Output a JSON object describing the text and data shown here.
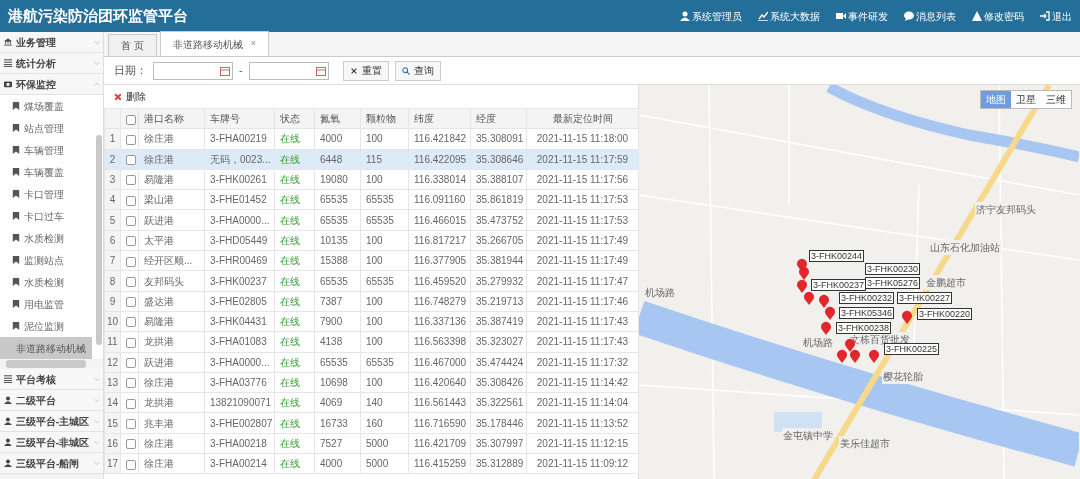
{
  "header": {
    "title": "港航污染防治团环监管平台",
    "menu": [
      {
        "label": "系统管理员"
      },
      {
        "label": "系统大数据"
      },
      {
        "label": "事件研发"
      },
      {
        "label": "消息列表"
      },
      {
        "label": "修改密码"
      },
      {
        "label": "退出"
      }
    ]
  },
  "sidebar": {
    "groups": [
      {
        "label": "业务管理",
        "expanded": false
      },
      {
        "label": "统计分析",
        "expanded": false
      },
      {
        "label": "环保监控",
        "expanded": true,
        "children": [
          {
            "label": "煤场覆盖",
            "selected": false
          },
          {
            "label": "站点管理",
            "selected": false
          },
          {
            "label": "车辆管理",
            "selected": false
          },
          {
            "label": "车辆覆盖",
            "selected": false
          },
          {
            "label": "卡口管理",
            "selected": false
          },
          {
            "label": "卡口过车",
            "selected": false
          },
          {
            "label": "水质检测",
            "selected": false
          },
          {
            "label": "监测站点",
            "selected": false
          },
          {
            "label": "水质检测",
            "selected": false
          },
          {
            "label": "用电监管",
            "selected": false
          },
          {
            "label": "泥位监测",
            "selected": false
          },
          {
            "label": "非道路移动机械",
            "selected": true
          }
        ]
      },
      {
        "label": "平台考核",
        "expanded": false
      },
      {
        "label": "二级平台",
        "expanded": false
      },
      {
        "label": "三级平台-主城区",
        "expanded": false
      },
      {
        "label": "三级平台-非城区",
        "expanded": false
      },
      {
        "label": "三级平台-船闸",
        "expanded": false
      }
    ]
  },
  "tabs": [
    {
      "label": "首 页",
      "selected": false,
      "closable": false
    },
    {
      "label": "非道路移动机械",
      "selected": true,
      "closable": true,
      "close": "×"
    }
  ],
  "filter": {
    "label": "日期：",
    "separator": "-",
    "buttons": [
      {
        "label": "重置"
      },
      {
        "label": "查询"
      }
    ]
  },
  "toolbar": {
    "delete": "删除"
  },
  "table": {
    "all_checked": false,
    "columns": [
      "港口名称",
      "车牌号",
      "状态",
      "氮氧",
      "颗粒物",
      "纬度",
      "经度",
      "最新定位时间"
    ],
    "rows": [
      {
        "index": "1",
        "checked": false,
        "selected": false,
        "cells": [
          "徐庄港",
          "3-FHA00219",
          "在线",
          "4000",
          "100",
          "116.421842",
          "35.308091",
          "2021-11-15 11:18:00"
        ]
      },
      {
        "index": "2",
        "checked": false,
        "selected": true,
        "cells": [
          "徐庄港",
          "无码，0023...",
          "在线",
          "6448",
          "115",
          "116.422095",
          "35.308646",
          "2021-11-15 11:17:59"
        ]
      },
      {
        "index": "3",
        "checked": false,
        "selected": false,
        "cells": [
          "易隆港",
          "3-FHK00261",
          "在线",
          "19080",
          "100",
          "116.338014",
          "35.388107",
          "2021-11-15 11:17:56"
        ]
      },
      {
        "index": "4",
        "checked": false,
        "selected": false,
        "cells": [
          "梁山港",
          "3-FHE01452",
          "在线",
          "65535",
          "65535",
          "116.091160",
          "35.861819",
          "2021-11-15 11:17:53"
        ]
      },
      {
        "index": "5",
        "checked": false,
        "selected": false,
        "cells": [
          "跃进港",
          "3-FHA0000...",
          "在线",
          "65535",
          "65535",
          "116.466015",
          "35.473752",
          "2021-11-15 11:17:53"
        ]
      },
      {
        "index": "6",
        "checked": false,
        "selected": false,
        "cells": [
          "太平港",
          "3-FHD05449",
          "在线",
          "10135",
          "100",
          "116.817217",
          "35.266705",
          "2021-11-15 11:17:49"
        ]
      },
      {
        "index": "7",
        "checked": false,
        "selected": false,
        "cells": [
          "经开区顺...",
          "3-FHR00469",
          "在线",
          "15388",
          "100",
          "116.377905",
          "35.381944",
          "2021-11-15 11:17:49"
        ]
      },
      {
        "index": "8",
        "checked": false,
        "selected": false,
        "cells": [
          "友邦码头",
          "3-FHK00237",
          "在线",
          "65535",
          "65535",
          "116.459520",
          "35.279932",
          "2021-11-15 11:17:47"
        ]
      },
      {
        "index": "9",
        "checked": false,
        "selected": false,
        "cells": [
          "盛达港",
          "3-FHE02805",
          "在线",
          "7387",
          "100",
          "116.748279",
          "35.219713",
          "2021-11-15 11:17:46"
        ]
      },
      {
        "index": "10",
        "checked": false,
        "selected": false,
        "cells": [
          "易隆港",
          "3-FHK04431",
          "在线",
          "7900",
          "100",
          "116.337136",
          "35.387419",
          "2021-11-15 11:17:43"
        ]
      },
      {
        "index": "11",
        "checked": false,
        "selected": false,
        "cells": [
          "龙拱港",
          "3-FHA01083",
          "在线",
          "4138",
          "100",
          "116.563398",
          "35.323027",
          "2021-11-15 11:17:43"
        ]
      },
      {
        "index": "12",
        "checked": false,
        "selected": false,
        "cells": [
          "跃进港",
          "3-FHA0000...",
          "在线",
          "65535",
          "65535",
          "116.467000",
          "35.474424",
          "2021-11-15 11:17:32"
        ]
      },
      {
        "index": "13",
        "checked": false,
        "selected": false,
        "cells": [
          "徐庄港",
          "3-FHA03776",
          "在线",
          "10698",
          "100",
          "116.420640",
          "35.308426",
          "2021-11-15 11:14:42"
        ]
      },
      {
        "index": "14",
        "checked": false,
        "selected": false,
        "cells": [
          "龙拱港",
          "13821090071",
          "在线",
          "4069",
          "140",
          "116.561443",
          "35.322561",
          "2021-11-15 11:14:04"
        ]
      },
      {
        "index": "15",
        "checked": false,
        "selected": false,
        "cells": [
          "兆丰港",
          "3-FHE002807",
          "在线",
          "16733",
          "160",
          "116.716590",
          "35.178446",
          "2021-11-15 11:13:52"
        ]
      },
      {
        "index": "16",
        "checked": false,
        "selected": false,
        "cells": [
          "徐庄港",
          "3-FHA00218",
          "在线",
          "7527",
          "5000",
          "116.421709",
          "35.307997",
          "2021-11-15 11:12:15"
        ]
      },
      {
        "index": "17",
        "checked": false,
        "selected": false,
        "cells": [
          "徐庄港",
          "3-FHA00214",
          "在线",
          "4000",
          "5000",
          "116.415259",
          "35.312889",
          "2021-11-15 11:09:12"
        ]
      }
    ]
  },
  "map": {
    "types": [
      {
        "label": "地图",
        "selected": true
      },
      {
        "label": "卫星",
        "selected": false
      },
      {
        "label": "三维",
        "selected": false
      }
    ],
    "places": [
      "济宁友邦码头",
      "山东石化加油站",
      "金鹏超市",
      "文栋百货批发",
      "樱花轮胎",
      "金屯镇中学",
      "美乐佳超市",
      "机场路",
      "机场路"
    ],
    "markers": [
      "3-FHK00244",
      "3-FHK00230",
      "3-FHK05276",
      "3-FHK00237",
      "3-FHK00232",
      "3-FHK00227",
      "3-FHK05346",
      "3-FHK00220",
      "3-FHK00238",
      "3-FHK00225"
    ]
  }
}
